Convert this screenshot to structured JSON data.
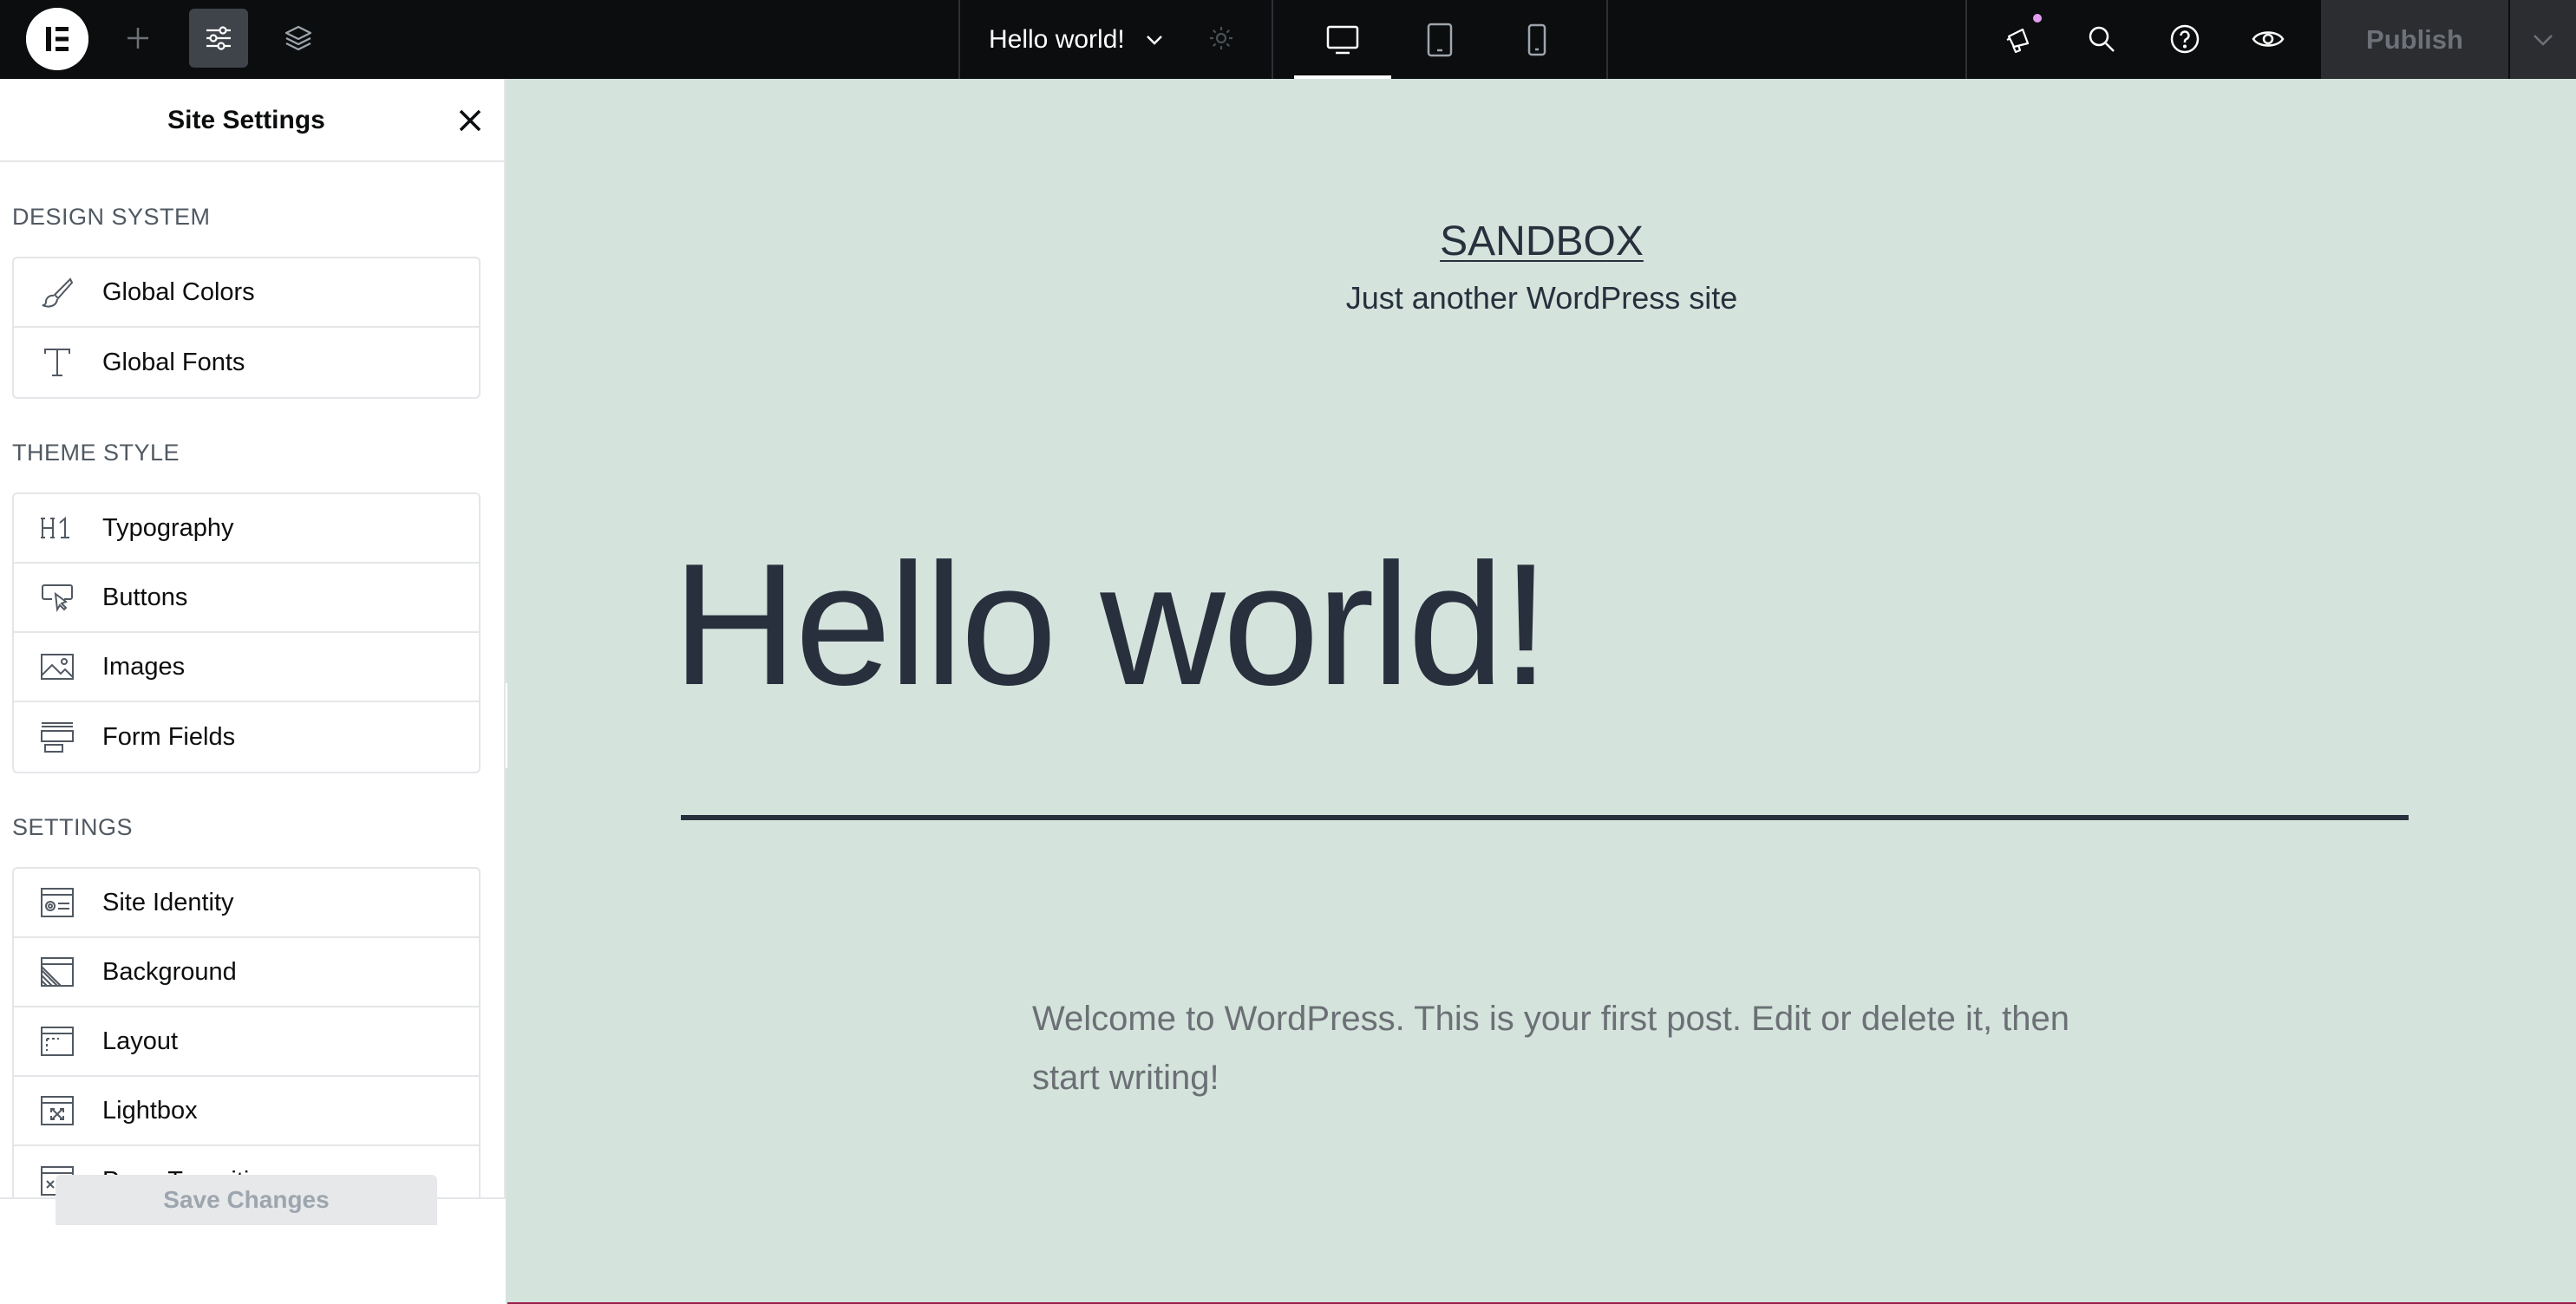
{
  "topbar": {
    "document_title": "Hello world!",
    "publish_label": "Publish",
    "icons": {
      "logo": "elementor-logo-icon",
      "add": "plus-icon",
      "site_settings": "sliders-icon",
      "structure": "layers-icon",
      "page_settings": "gear-icon",
      "desktop": "desktop-icon",
      "tablet": "tablet-icon",
      "mobile": "mobile-icon",
      "whats_new": "megaphone-icon",
      "search": "search-icon",
      "help": "help-icon",
      "preview": "eye-icon",
      "publish_options": "chevron-down-icon"
    },
    "colors": {
      "background": "#0c0d0e",
      "active_button": "#3f444b",
      "notification_dot": "#e39bf0"
    }
  },
  "panel": {
    "title": "Site Settings",
    "sections": [
      {
        "label": "DESIGN SYSTEM",
        "items": [
          {
            "label": "Global Colors",
            "icon": "brush-icon"
          },
          {
            "label": "Global Fonts",
            "icon": "text-t-icon"
          }
        ]
      },
      {
        "label": "THEME STYLE",
        "items": [
          {
            "label": "Typography",
            "icon": "heading-h1-icon"
          },
          {
            "label": "Buttons",
            "icon": "button-cursor-icon"
          },
          {
            "label": "Images",
            "icon": "image-icon"
          },
          {
            "label": "Form Fields",
            "icon": "form-fields-icon"
          }
        ]
      },
      {
        "label": "SETTINGS",
        "items": [
          {
            "label": "Site Identity",
            "icon": "site-identity-icon"
          },
          {
            "label": "Background",
            "icon": "background-icon"
          },
          {
            "label": "Layout",
            "icon": "layout-icon"
          },
          {
            "label": "Lightbox",
            "icon": "lightbox-icon"
          },
          {
            "label": "Page Transitions",
            "icon": "page-transitions-icon"
          }
        ]
      }
    ],
    "save_label": "Save Changes"
  },
  "canvas": {
    "site_title": "SANDBOX",
    "site_tagline": "Just another WordPress site",
    "post_title": "Hello world!",
    "post_body": "Welcome to WordPress. This is your first post. Edit or delete it, then start writing!",
    "colors": {
      "background": "#d5e3dd",
      "text": "#28303d"
    }
  }
}
